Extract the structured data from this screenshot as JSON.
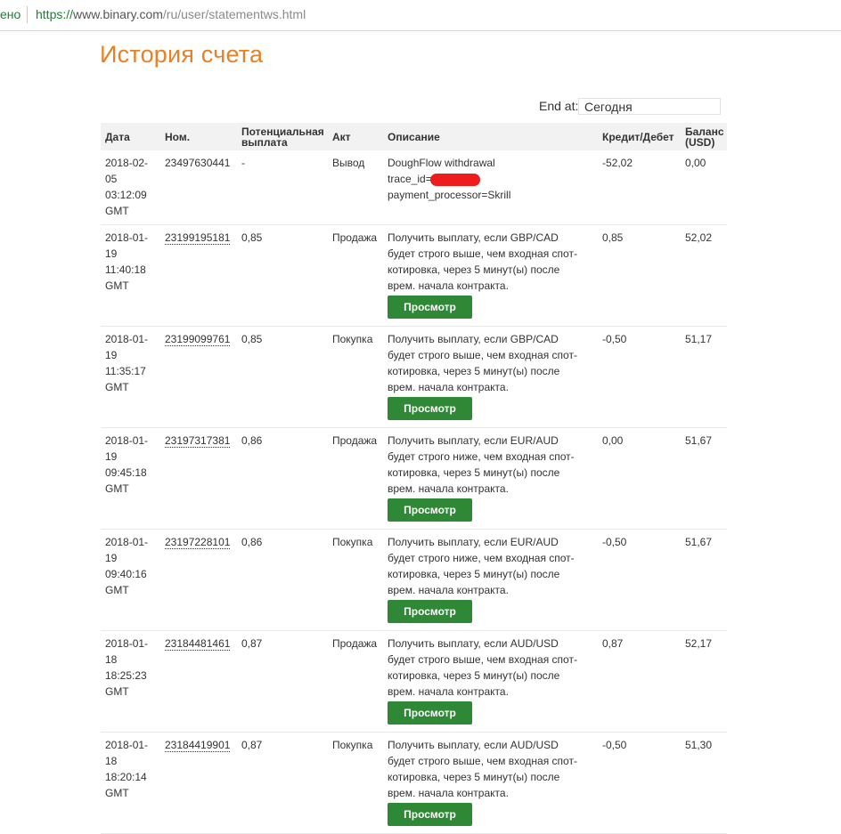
{
  "browser": {
    "secure_label": "ено",
    "url_proto": "https://",
    "url_host": "www.binary.com",
    "url_path": "/ru/user/statementws.html"
  },
  "page": {
    "title": "История счета",
    "end_at_label": "End at:",
    "end_at_value": "Сегодня"
  },
  "table": {
    "headers": {
      "date": "Дата",
      "ref": "Ном.",
      "payout": "Потенциальная выплата",
      "action": "Акт",
      "description": "Описание",
      "credit": "Кредит/Дебет",
      "balance": "Баланс (USD)"
    },
    "view_label": "Просмотр",
    "rows": [
      {
        "date_l1": "2018-02-",
        "date_l2": "05",
        "date_l3": "03:12:09",
        "date_l4": "GMT",
        "ref": "23497630441",
        "payout": "-",
        "action": "Вывод",
        "desc_l1": "DoughFlow withdrawal",
        "desc_l2": "trace_id=",
        "desc_l3": "payment_processor=Skrill",
        "desc_l4": "",
        "credit": "-52,02",
        "balance": "0,00"
      },
      {
        "date_l1": "2018-01-",
        "date_l2": "19",
        "date_l3": "11:40:18",
        "date_l4": "GMT",
        "ref": "23199195181",
        "payout": "0,85",
        "action": "Продажа",
        "desc_l1": "Получить выплату, если GBP/CAD",
        "desc_l2": "будет строго выше, чем входная спот-",
        "desc_l3": "котировка, через 5 минут(ы) после",
        "desc_l4": "врем. начала контракта.",
        "credit": "0,85",
        "balance": "52,02"
      },
      {
        "date_l1": "2018-01-",
        "date_l2": "19",
        "date_l3": "11:35:17",
        "date_l4": "GMT",
        "ref": "23199099761",
        "payout": "0,85",
        "action": "Покупка",
        "desc_l1": "Получить выплату, если GBP/CAD",
        "desc_l2": "будет строго выше, чем входная спот-",
        "desc_l3": "котировка, через 5 минут(ы) после",
        "desc_l4": "врем. начала контракта.",
        "credit": "-0,50",
        "balance": "51,17"
      },
      {
        "date_l1": "2018-01-",
        "date_l2": "19",
        "date_l3": "09:45:18",
        "date_l4": "GMT",
        "ref": "23197317381",
        "payout": "0,86",
        "action": "Продажа",
        "desc_l1": "Получить выплату, если EUR/AUD",
        "desc_l2": "будет строго ниже, чем входная спот-",
        "desc_l3": "котировка, через 5 минут(ы) после",
        "desc_l4": "врем. начала контракта.",
        "credit": "0,00",
        "balance": "51,67"
      },
      {
        "date_l1": "2018-01-",
        "date_l2": "19",
        "date_l3": "09:40:16",
        "date_l4": "GMT",
        "ref": "23197228101",
        "payout": "0,86",
        "action": "Покупка",
        "desc_l1": "Получить выплату, если EUR/AUD",
        "desc_l2": "будет строго ниже, чем входная спот-",
        "desc_l3": "котировка, через 5 минут(ы) после",
        "desc_l4": "врем. начала контракта.",
        "credit": "-0,50",
        "balance": "51,67"
      },
      {
        "date_l1": "2018-01-",
        "date_l2": "18",
        "date_l3": "18:25:23",
        "date_l4": "GMT",
        "ref": "23184481461",
        "payout": "0,87",
        "action": "Продажа",
        "desc_l1": "Получить выплату, если AUD/USD",
        "desc_l2": "будет строго выше, чем входная спот-",
        "desc_l3": "котировка, через 5 минут(ы) после",
        "desc_l4": "врем. начала контракта.",
        "credit": "0,87",
        "balance": "52,17"
      },
      {
        "date_l1": "2018-01-",
        "date_l2": "18",
        "date_l3": "18:20:14",
        "date_l4": "GMT",
        "ref": "23184419901",
        "payout": "0,87",
        "action": "Покупка",
        "desc_l1": "Получить выплату, если AUD/USD",
        "desc_l2": "будет строго выше, чем входная спот-",
        "desc_l3": "котировка, через 5 минут(ы) после",
        "desc_l4": "врем. начала контракта.",
        "credit": "-0,50",
        "balance": "51,30"
      }
    ]
  }
}
